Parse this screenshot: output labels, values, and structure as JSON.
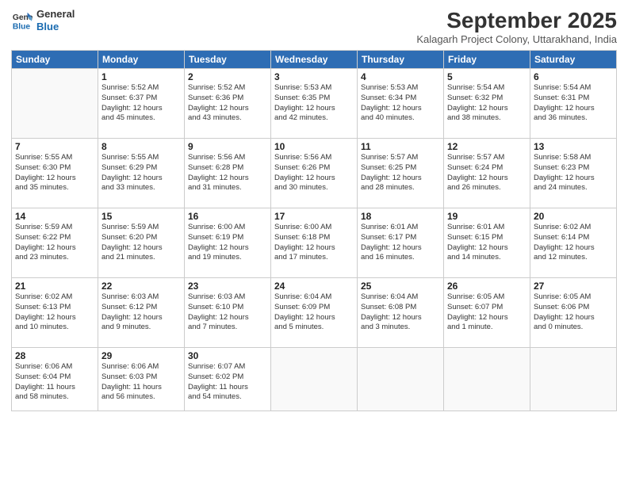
{
  "logo": {
    "line1": "General",
    "line2": "Blue"
  },
  "title": "September 2025",
  "subtitle": "Kalagarh Project Colony, Uttarakhand, India",
  "days_header": [
    "Sunday",
    "Monday",
    "Tuesday",
    "Wednesday",
    "Thursday",
    "Friday",
    "Saturday"
  ],
  "weeks": [
    [
      {
        "num": "",
        "info": ""
      },
      {
        "num": "1",
        "info": "Sunrise: 5:52 AM\nSunset: 6:37 PM\nDaylight: 12 hours\nand 45 minutes."
      },
      {
        "num": "2",
        "info": "Sunrise: 5:52 AM\nSunset: 6:36 PM\nDaylight: 12 hours\nand 43 minutes."
      },
      {
        "num": "3",
        "info": "Sunrise: 5:53 AM\nSunset: 6:35 PM\nDaylight: 12 hours\nand 42 minutes."
      },
      {
        "num": "4",
        "info": "Sunrise: 5:53 AM\nSunset: 6:34 PM\nDaylight: 12 hours\nand 40 minutes."
      },
      {
        "num": "5",
        "info": "Sunrise: 5:54 AM\nSunset: 6:32 PM\nDaylight: 12 hours\nand 38 minutes."
      },
      {
        "num": "6",
        "info": "Sunrise: 5:54 AM\nSunset: 6:31 PM\nDaylight: 12 hours\nand 36 minutes."
      }
    ],
    [
      {
        "num": "7",
        "info": "Sunrise: 5:55 AM\nSunset: 6:30 PM\nDaylight: 12 hours\nand 35 minutes."
      },
      {
        "num": "8",
        "info": "Sunrise: 5:55 AM\nSunset: 6:29 PM\nDaylight: 12 hours\nand 33 minutes."
      },
      {
        "num": "9",
        "info": "Sunrise: 5:56 AM\nSunset: 6:28 PM\nDaylight: 12 hours\nand 31 minutes."
      },
      {
        "num": "10",
        "info": "Sunrise: 5:56 AM\nSunset: 6:26 PM\nDaylight: 12 hours\nand 30 minutes."
      },
      {
        "num": "11",
        "info": "Sunrise: 5:57 AM\nSunset: 6:25 PM\nDaylight: 12 hours\nand 28 minutes."
      },
      {
        "num": "12",
        "info": "Sunrise: 5:57 AM\nSunset: 6:24 PM\nDaylight: 12 hours\nand 26 minutes."
      },
      {
        "num": "13",
        "info": "Sunrise: 5:58 AM\nSunset: 6:23 PM\nDaylight: 12 hours\nand 24 minutes."
      }
    ],
    [
      {
        "num": "14",
        "info": "Sunrise: 5:59 AM\nSunset: 6:22 PM\nDaylight: 12 hours\nand 23 minutes."
      },
      {
        "num": "15",
        "info": "Sunrise: 5:59 AM\nSunset: 6:20 PM\nDaylight: 12 hours\nand 21 minutes."
      },
      {
        "num": "16",
        "info": "Sunrise: 6:00 AM\nSunset: 6:19 PM\nDaylight: 12 hours\nand 19 minutes."
      },
      {
        "num": "17",
        "info": "Sunrise: 6:00 AM\nSunset: 6:18 PM\nDaylight: 12 hours\nand 17 minutes."
      },
      {
        "num": "18",
        "info": "Sunrise: 6:01 AM\nSunset: 6:17 PM\nDaylight: 12 hours\nand 16 minutes."
      },
      {
        "num": "19",
        "info": "Sunrise: 6:01 AM\nSunset: 6:15 PM\nDaylight: 12 hours\nand 14 minutes."
      },
      {
        "num": "20",
        "info": "Sunrise: 6:02 AM\nSunset: 6:14 PM\nDaylight: 12 hours\nand 12 minutes."
      }
    ],
    [
      {
        "num": "21",
        "info": "Sunrise: 6:02 AM\nSunset: 6:13 PM\nDaylight: 12 hours\nand 10 minutes."
      },
      {
        "num": "22",
        "info": "Sunrise: 6:03 AM\nSunset: 6:12 PM\nDaylight: 12 hours\nand 9 minutes."
      },
      {
        "num": "23",
        "info": "Sunrise: 6:03 AM\nSunset: 6:10 PM\nDaylight: 12 hours\nand 7 minutes."
      },
      {
        "num": "24",
        "info": "Sunrise: 6:04 AM\nSunset: 6:09 PM\nDaylight: 12 hours\nand 5 minutes."
      },
      {
        "num": "25",
        "info": "Sunrise: 6:04 AM\nSunset: 6:08 PM\nDaylight: 12 hours\nand 3 minutes."
      },
      {
        "num": "26",
        "info": "Sunrise: 6:05 AM\nSunset: 6:07 PM\nDaylight: 12 hours\nand 1 minute."
      },
      {
        "num": "27",
        "info": "Sunrise: 6:05 AM\nSunset: 6:06 PM\nDaylight: 12 hours\nand 0 minutes."
      }
    ],
    [
      {
        "num": "28",
        "info": "Sunrise: 6:06 AM\nSunset: 6:04 PM\nDaylight: 11 hours\nand 58 minutes."
      },
      {
        "num": "29",
        "info": "Sunrise: 6:06 AM\nSunset: 6:03 PM\nDaylight: 11 hours\nand 56 minutes."
      },
      {
        "num": "30",
        "info": "Sunrise: 6:07 AM\nSunset: 6:02 PM\nDaylight: 11 hours\nand 54 minutes."
      },
      {
        "num": "",
        "info": ""
      },
      {
        "num": "",
        "info": ""
      },
      {
        "num": "",
        "info": ""
      },
      {
        "num": "",
        "info": ""
      }
    ]
  ]
}
